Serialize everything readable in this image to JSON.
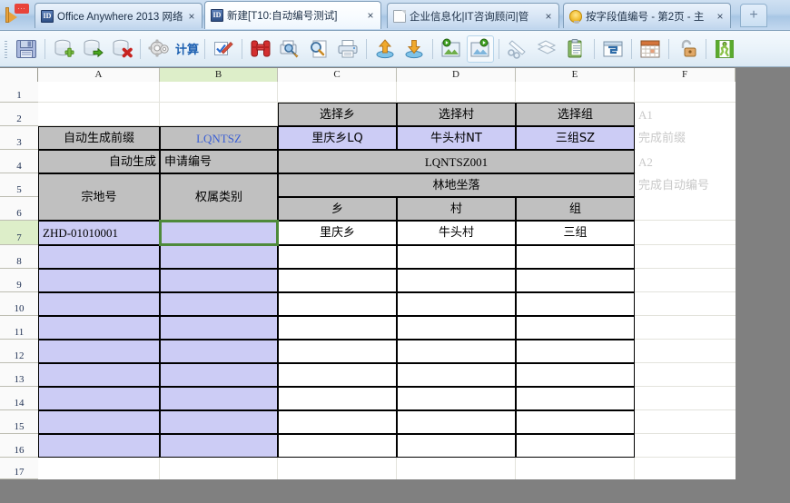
{
  "window": {
    "back_icon": "back-arrow-flag-icon",
    "notification_badge": "..."
  },
  "tabs": [
    {
      "icon": "id-icon",
      "icon_text": "ID",
      "label": "Office Anywhere 2013 网络",
      "close": "×",
      "active": false
    },
    {
      "icon": "id-icon",
      "icon_text": "ID",
      "label": "新建[T10:自动编号测试]",
      "close": "×",
      "active": true
    },
    {
      "icon": "page-icon",
      "icon_text": "",
      "label": "企业信息化|IT咨询顾问|管",
      "close": "×",
      "active": false
    },
    {
      "icon": "bulb-icon",
      "icon_text": "",
      "label": "按字段值编号 - 第2页 - 主",
      "close": "×",
      "active": false
    }
  ],
  "new_tab_label": "+",
  "toolbar": {
    "items": [
      {
        "name": "save-button",
        "icon": "floppy-save-icon"
      },
      {
        "name": "add-record-button",
        "icon": "database-add-icon"
      },
      {
        "name": "import-record-button",
        "icon": "database-import-icon"
      },
      {
        "name": "delete-record-button",
        "icon": "database-delete-icon"
      },
      {
        "name": "settings-button",
        "icon": "gear-icon"
      },
      {
        "name": "calculate-button",
        "icon": "calc-text-icon",
        "text": "计算"
      },
      {
        "name": "check-edit-button",
        "icon": "checkbox-pen-icon"
      },
      {
        "name": "find-button",
        "icon": "binoculars-icon"
      },
      {
        "name": "search-replace-button",
        "icon": "search-print-icon"
      },
      {
        "name": "preview-button",
        "icon": "magnifier-page-icon"
      },
      {
        "name": "print-button",
        "icon": "printer-icon"
      },
      {
        "name": "upload-button",
        "icon": "upload-arrow-icon"
      },
      {
        "name": "download-button",
        "icon": "download-arrow-icon"
      },
      {
        "name": "open-image-button",
        "icon": "image-play-icon"
      },
      {
        "name": "open-folder-button",
        "icon": "folder-play-icon"
      },
      {
        "name": "cut-button",
        "icon": "scissors-icon"
      },
      {
        "name": "copy-button",
        "icon": "copy-pages-icon"
      },
      {
        "name": "paste-button",
        "icon": "clipboard-icon"
      },
      {
        "name": "window-button",
        "icon": "window-icon"
      },
      {
        "name": "calendar-button",
        "icon": "calendar-icon"
      },
      {
        "name": "unlock-button",
        "icon": "padlock-open-icon"
      },
      {
        "name": "run-button",
        "icon": "running-man-icon"
      }
    ],
    "calc_label": "计算"
  },
  "sheet": {
    "columns": [
      "A",
      "B",
      "C",
      "D",
      "E",
      "F"
    ],
    "selected_column": "B",
    "rows": [
      "1",
      "2",
      "3",
      "4",
      "5",
      "6",
      "7",
      "8",
      "9",
      "10",
      "11",
      "12",
      "13",
      "14",
      "15",
      "16",
      "17"
    ],
    "selected_row": "7",
    "selection": "B7",
    "cells": {
      "c2": "选择乡",
      "d2": "选择村",
      "e2": "选择组",
      "a3": "自动生成前缀",
      "b3": "LQNTSZ",
      "c3": "里庆乡LQ",
      "d3": "牛头村NT",
      "e3": "三组SZ",
      "a4": "自动生成",
      "b4": "申请编号",
      "cde4": "LQNTSZ001",
      "a56": "宗地号",
      "b56": "权属类别",
      "cde5": "林地坐落",
      "c6": "乡",
      "d6": "村",
      "e6": "组",
      "a7": "ZHD-01010001",
      "b7": "",
      "c7": "里庆乡",
      "d7": "牛头村",
      "e7": "三组",
      "f2": "A1",
      "f3": "完成前缀",
      "f4": "A2",
      "f5": "完成自动编号"
    }
  }
}
